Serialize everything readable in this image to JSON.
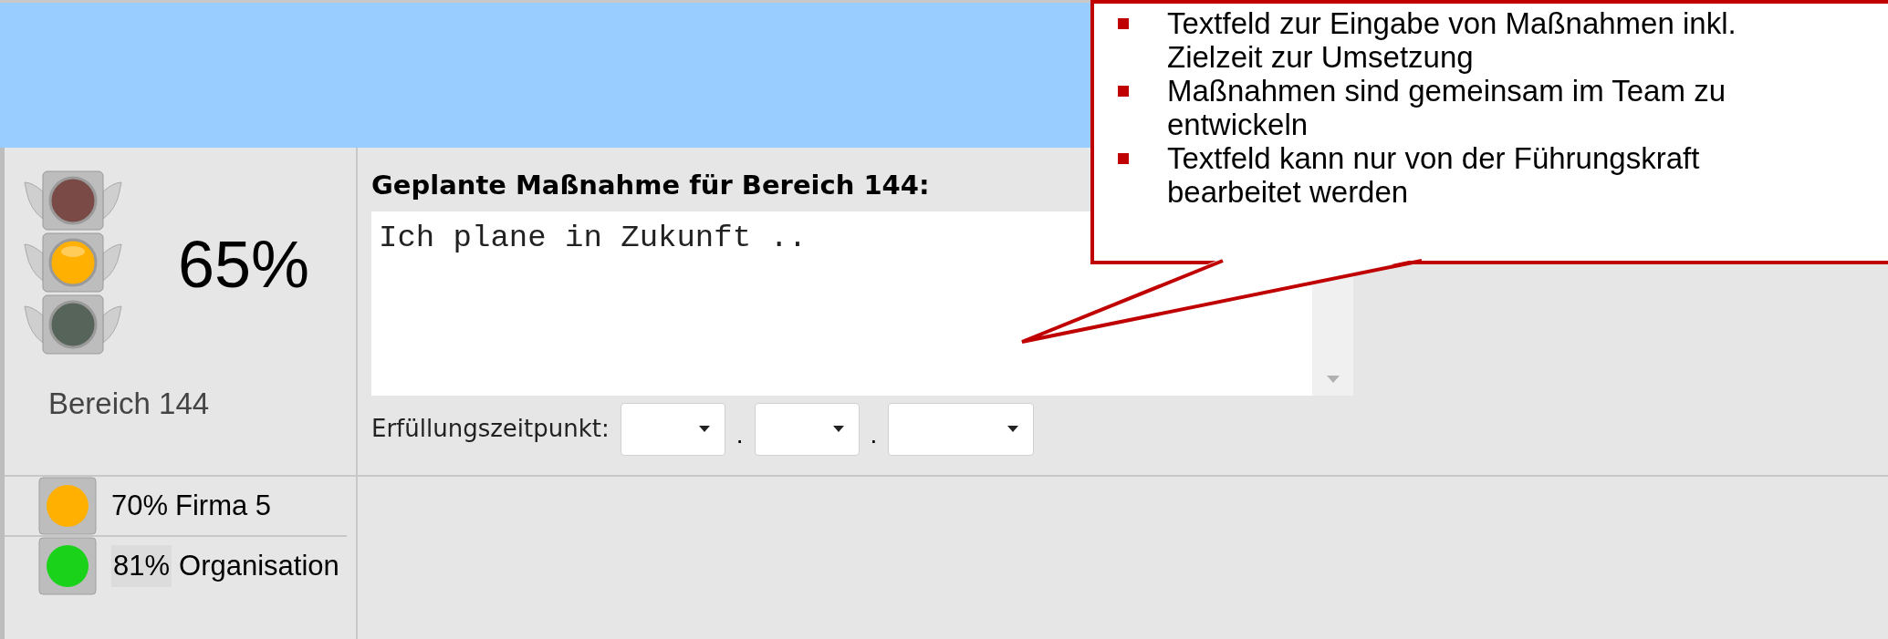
{
  "status": {
    "lamps": [
      {
        "color": "#7a4a46",
        "on": false
      },
      {
        "color": "#ffb000",
        "on": true
      },
      {
        "color": "#56645a",
        "on": false
      }
    ],
    "percent": "65%",
    "label": "Bereich 144"
  },
  "plan": {
    "heading": "Geplante Maßnahme für Bereich 144:",
    "value": "Ich plane in Zukunft ..",
    "deadline_label": "Erfüllungszeitpunkt:",
    "separators": [
      ".",
      "."
    ]
  },
  "summaries": [
    {
      "color": "#ffb000",
      "percent": "70%",
      "name": "Firma 5",
      "highlighted": false
    },
    {
      "color": "#19d219",
      "percent": "81%",
      "name": "Organisation",
      "highlighted": true
    }
  ],
  "callout": {
    "bullets": [
      "Textfeld zur Eingabe von Maßnahmen inkl. Zielzeit zur Umsetzung",
      "Maßnahmen sind gemeinsam im Team zu entwickeln",
      "Textfeld kann nur von der Führungskraft bearbeitet werden"
    ]
  }
}
